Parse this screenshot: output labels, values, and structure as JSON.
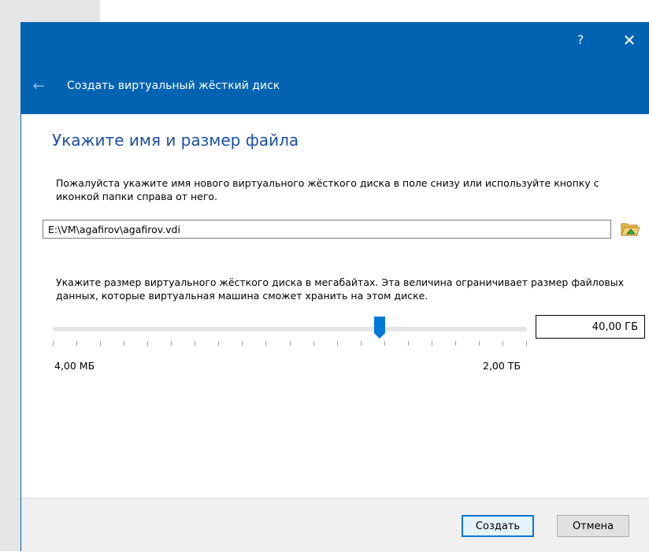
{
  "window": {
    "help_label": "?",
    "close_label": "✕",
    "back_icon": "←",
    "title": "Создать виртуальный жёсткий диск"
  },
  "page": {
    "heading": "Укажите имя и размер файла",
    "name_description": "Пожалуйста укажите имя нового виртуального жёсткого диска в поле снизу или используйте кнопку с иконкой папки справа от него.",
    "file_path": "E:\\VM\\agafirov\\agafirov.vdi",
    "folder_icon": "folder-open-icon",
    "size_description": "Укажите размер виртуального жёсткого диска в мегабайтах. Эта величина ограничивает размер файловых данных, которые виртуальная машина сможет хранить на этом диске.",
    "size_value": "40,00 ГБ",
    "slider": {
      "min_label": "4,00 МБ",
      "max_label": "2,00 ТБ",
      "position": 0.69,
      "tick_count": 20
    }
  },
  "buttons": {
    "create": "Создать",
    "cancel": "Отмена"
  },
  "colors": {
    "accent": "#0063b1",
    "heading": "#1c4fa1",
    "slider_thumb": "#0078d7"
  }
}
